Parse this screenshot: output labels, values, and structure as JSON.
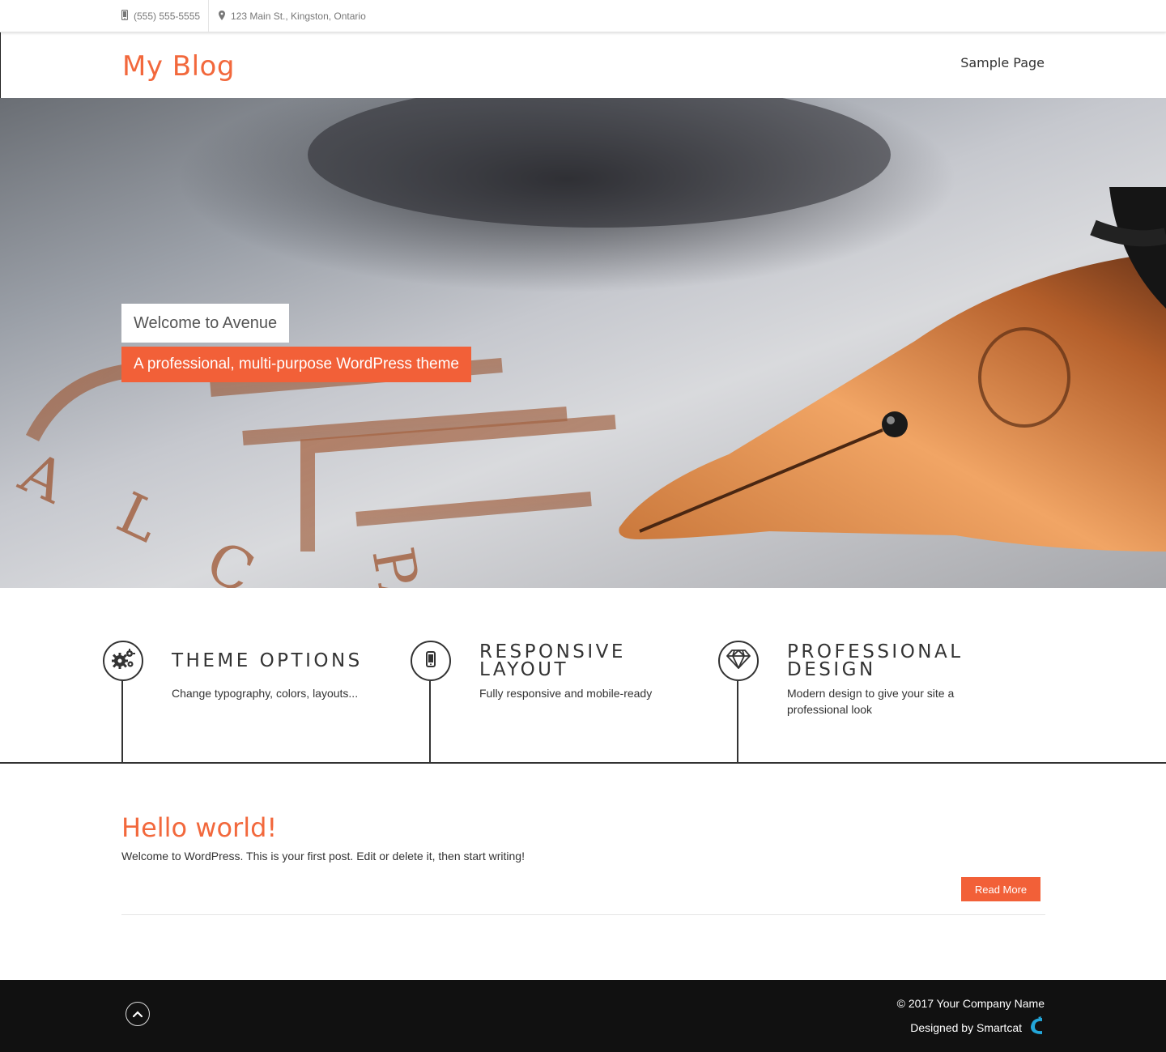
{
  "topbar": {
    "phone": "(555) 555-5555",
    "address": "123 Main St., Kingston, Ontario",
    "phone_icon": "mobile-phone-icon",
    "address_icon": "map-marker-icon"
  },
  "header": {
    "site_title": "My Blog",
    "nav": [
      "Sample Page"
    ]
  },
  "hero": {
    "title": "Welcome to Avenue",
    "subtitle": "A professional, multi-purpose WordPress theme"
  },
  "features": [
    {
      "icon": "gears-icon",
      "title": "Theme Options",
      "desc": "Change typography, colors, layouts..."
    },
    {
      "icon": "mobile-icon",
      "title": "Responsive Layout",
      "desc": "Fully responsive and mobile-ready"
    },
    {
      "icon": "diamond-icon",
      "title": "Professional Design",
      "desc": "Modern design to give your site a professional look"
    }
  ],
  "post": {
    "title": "Hello world!",
    "excerpt": "Welcome to WordPress. This is your first post. Edit or delete it, then start writing!",
    "read_more": "Read More"
  },
  "footer": {
    "copyright": "© 2017 Your Company Name",
    "designed_by": "Designed by Smartcat",
    "scroll_icon": "chevron-up-icon",
    "brand_icon": "smartcat-logo-icon"
  },
  "colors": {
    "accent": "#f26038",
    "dark": "#111111",
    "text": "#333333"
  }
}
